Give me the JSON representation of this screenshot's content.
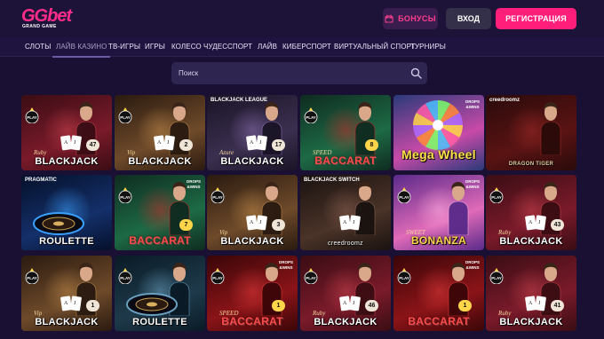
{
  "header": {
    "logo": {
      "main": "GGbet",
      "sub": "GRAND GAME"
    },
    "bonus_label": "БОНУСЫ",
    "login_label": "ВХОД",
    "register_label": "РЕГИСТРАЦИЯ"
  },
  "nav": {
    "items": [
      {
        "label": "СЛОТЫ"
      },
      {
        "label": "ЛАЙВ КАЗИНО",
        "active": true
      },
      {
        "label": "ТВ-ИГРЫ"
      },
      {
        "label": "ИГРЫ"
      },
      {
        "label": "КОЛЕСО ЧУДЕС"
      },
      {
        "label": "СПОРТ"
      },
      {
        "label": "ЛАЙВ"
      },
      {
        "label": "КИБЕРСПОРТ"
      },
      {
        "label": "ВИРТУАЛЬНЫЙ СПОРТ"
      },
      {
        "label": "ТУРНИРЫ"
      }
    ]
  },
  "search": {
    "placeholder": "Поиск"
  },
  "colors": {
    "accent": "#ff1f7a",
    "background": "#1a1033",
    "nav": "#1f1440"
  },
  "games": [
    {
      "name": "Ruby Blackjack",
      "pre": "Ruby",
      "title": "BLACKJACK",
      "count": "47",
      "play": true,
      "drops": false,
      "kind": "blackjack",
      "theme": "red"
    },
    {
      "name": "Vip Blackjack",
      "pre": "Vip",
      "title": "BLACKJACK",
      "count": "2",
      "play": true,
      "drops": false,
      "kind": "blackjack",
      "theme": "warm"
    },
    {
      "name": "Azure Blackjack",
      "pre": "Azure",
      "title": "BLACKJACK",
      "count": "17",
      "top": "BLACKJACK LEAGUE",
      "play": false,
      "drops": false,
      "kind": "blackjack",
      "theme": "dark"
    },
    {
      "name": "Speed Baccarat",
      "pre": "SPEED",
      "title": "BACCARAT",
      "count": "8",
      "play": true,
      "drops": false,
      "kind": "baccarat",
      "theme": "green"
    },
    {
      "name": "Mega Wheel",
      "pre": "",
      "title": "Mega Wheel",
      "count": "",
      "play": false,
      "drops": true,
      "kind": "wheel",
      "theme": "pink"
    },
    {
      "name": "Dragon Tiger",
      "pre": "",
      "title": "DRAGON TIGER",
      "count": "",
      "top": "creedroomz",
      "play": false,
      "drops": false,
      "kind": "dragon",
      "theme": "maroon"
    },
    {
      "name": "Roulette",
      "pre": "",
      "title": "ROULETTE",
      "count": "",
      "top": "PRAGMATIC",
      "play": false,
      "drops": false,
      "kind": "roulette",
      "theme": "blue"
    },
    {
      "name": "Baccarat 7",
      "pre": "",
      "title": "BACCARAT",
      "count": "7",
      "play": true,
      "drops": true,
      "kind": "baccarat",
      "theme": "green"
    },
    {
      "name": "Vip Blackjack 3",
      "pre": "Vip",
      "title": "BLACKJACK",
      "count": "3",
      "play": true,
      "drops": false,
      "kind": "blackjack",
      "theme": "warm"
    },
    {
      "name": "Blackjack Switch",
      "pre": "",
      "title": "creedroomz",
      "count": "",
      "top": "BLACKJACK SWITCH",
      "play": false,
      "drops": false,
      "kind": "switch",
      "theme": "brown"
    },
    {
      "name": "Sweet Bonanza Candyland",
      "pre": "SWEET",
      "title": "BONANZA",
      "count": "",
      "play": true,
      "drops": true,
      "kind": "candy",
      "theme": "candy"
    },
    {
      "name": "Ruby Blackjack 43",
      "pre": "Ruby",
      "title": "BLACKJACK",
      "count": "43",
      "play": true,
      "drops": false,
      "kind": "blackjack",
      "theme": "red"
    },
    {
      "name": "Vip Blackjack 1",
      "pre": "Vip",
      "title": "BLACKJACK",
      "count": "1",
      "play": true,
      "drops": false,
      "kind": "blackjack",
      "theme": "warm"
    },
    {
      "name": "Roulette 2",
      "pre": "",
      "title": "ROULETTE",
      "count": "",
      "play": true,
      "drops": false,
      "kind": "roulette2",
      "theme": "teal"
    },
    {
      "name": "Speed Baccarat 1",
      "pre": "SPEED",
      "title": "BACCARAT",
      "count": "1",
      "play": true,
      "drops": true,
      "kind": "baccarat",
      "theme": "redbac"
    },
    {
      "name": "Ruby Blackjack 46",
      "pre": "Ruby",
      "title": "BLACKJACK",
      "count": "46",
      "play": true,
      "drops": false,
      "kind": "blackjack",
      "theme": "red"
    },
    {
      "name": "Baccarat 1",
      "pre": "",
      "title": "BACCARAT",
      "count": "1",
      "play": true,
      "drops": true,
      "kind": "baccarat",
      "theme": "redbac"
    },
    {
      "name": "Ruby Blackjack 41",
      "pre": "Ruby",
      "title": "BLACKJACK",
      "count": "41",
      "play": true,
      "drops": false,
      "kind": "blackjack",
      "theme": "red"
    }
  ]
}
